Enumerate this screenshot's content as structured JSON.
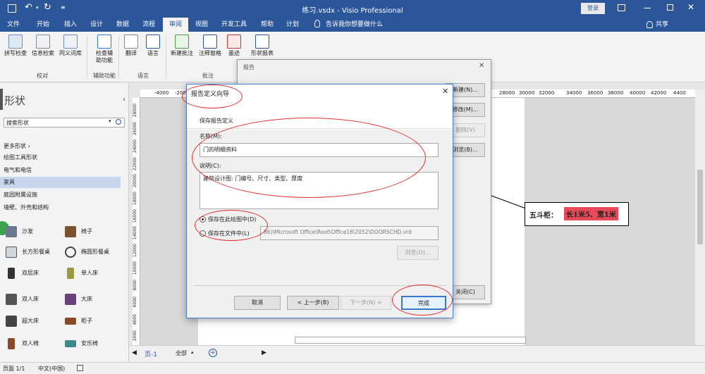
{
  "titlebar": {
    "title": "练习.vsdx  -  Visio Professional",
    "login": "登录"
  },
  "menu": {
    "items": [
      "文件",
      "开始",
      "插入",
      "设计",
      "数据",
      "流程",
      "审阅",
      "视图",
      "开发工具",
      "帮助",
      "计划"
    ],
    "active": "审阅",
    "tell_me": "告诉我你想要做什么",
    "share": "共享"
  },
  "ribbon": {
    "buttons": [
      "拼写检查",
      "信息检索",
      "同义词库",
      "检查辅助功能",
      "翻译",
      "语言",
      "新建批注",
      "注释窗格",
      "墨迹",
      "形状报表"
    ],
    "groups": [
      "校对",
      "辅助功能",
      "语言",
      "批注"
    ]
  },
  "shapes_panel": {
    "title": "形状",
    "search_placeholder": "搜索形状",
    "more": "更多形状",
    "categories": [
      "绘图工具形状",
      "电气和电信",
      "家具",
      "庭园附属设施",
      "墙壁、外壳和结构"
    ],
    "selected": "家具",
    "items": [
      "沙发",
      "椅子",
      "长方形餐桌",
      "椭圆形餐桌",
      "双层床",
      "单人床",
      "双人床",
      "大床",
      "超大床",
      "柜子",
      "双人椅",
      "安乐椅"
    ]
  },
  "ruler_top_labels": [
    "-4000",
    "-2000",
    "28000",
    "30000",
    "32000",
    "34000",
    "36000",
    "38000",
    "40000",
    "42000",
    "4400"
  ],
  "ruler_left_labels": [
    "28000",
    "26000",
    "24000",
    "22000",
    "20000",
    "18000",
    "16000",
    "14000",
    "12000",
    "10000",
    "8000",
    "6000",
    "4000",
    "2000",
    "0"
  ],
  "callout": {
    "prefix": "五斗柜：",
    "highlight": "长1米5、宽1米"
  },
  "report_dialog": {
    "title": "报告",
    "buttons": [
      "新建(N)...",
      "修改(M)...",
      "删除(V)",
      "浏览(B)...",
      "关闭(C)"
    ]
  },
  "wizard": {
    "title": "报告定义向导",
    "section": "保存报告定义",
    "name_label": "名称(M):",
    "name_value": "门的明细资料",
    "desc_label": "说明(C):",
    "desc_value": "建筑设计图: 门编号、尺寸、类型、厚度",
    "option_drawing": "保存在此绘图中(D)",
    "option_file": "保存在文件中(L)",
    "path": "86)\\Microsoft Office\\Root\\Office16\\2052\\DOORSCHD.vrd",
    "browse": "浏览(O)...",
    "cancel": "取消",
    "back": "< 上一步(B)",
    "next": "下一步(N) >",
    "finish": "完成"
  },
  "tabbar": {
    "page": "页-1",
    "all": "全部"
  },
  "status": {
    "page": "页面 1/1",
    "lang": "中文(中国)"
  },
  "colors": {
    "accent": "#2b579a",
    "annotation": "#e03030",
    "highlight": "#e84a5a"
  }
}
